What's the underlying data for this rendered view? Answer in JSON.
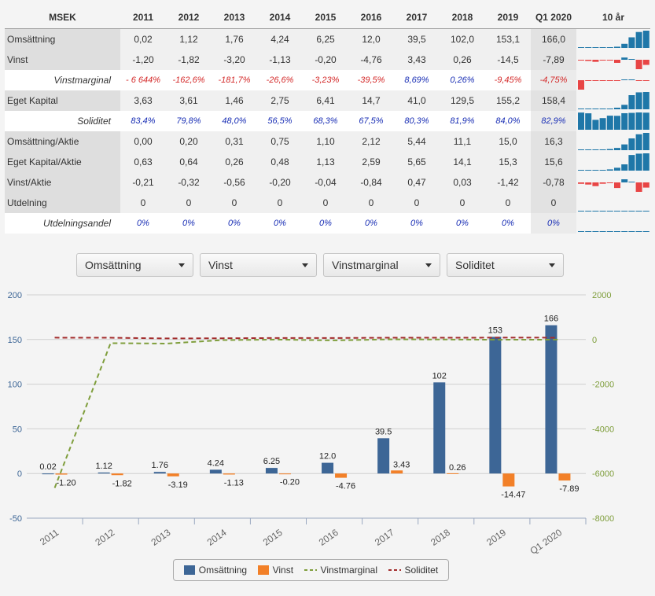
{
  "table": {
    "unit_header": "MSEK",
    "years": [
      "2011",
      "2012",
      "2013",
      "2014",
      "2015",
      "2016",
      "2017",
      "2018",
      "2019",
      "Q1 2020"
    ],
    "spark_header": "10 år",
    "rows": [
      {
        "label": "Omsättning",
        "style": "grey",
        "italic": false,
        "values": [
          "0,02",
          "1,12",
          "1,76",
          "4,24",
          "6,25",
          "12,0",
          "39,5",
          "102,0",
          "153,1",
          "166,0"
        ],
        "spark": [
          0.02,
          1.12,
          1.76,
          4.24,
          6.25,
          12.0,
          39.5,
          102.0,
          153.1,
          166.0
        ]
      },
      {
        "label": "Vinst",
        "style": "grey",
        "italic": false,
        "values": [
          "-1,20",
          "-1,82",
          "-3,20",
          "-1,13",
          "-0,20",
          "-4,76",
          "3,43",
          "0,26",
          "-14,5",
          "-7,89"
        ],
        "spark": [
          -1.2,
          -1.82,
          -3.2,
          -1.13,
          -0.2,
          -4.76,
          3.43,
          0.26,
          -14.5,
          -7.89
        ]
      },
      {
        "label": "Vinstmarginal",
        "style": "white",
        "italic": true,
        "values": [
          "- 6 644%",
          "-162,6%",
          "-181,7%",
          "-26,6%",
          "-3,23%",
          "-39,5%",
          "8,69%",
          "0,26%",
          "-9,45%",
          "-4,75%"
        ],
        "spark": [
          -6644,
          -162.6,
          -181.7,
          -26.6,
          -3.23,
          -39.5,
          8.69,
          0.26,
          -9.45,
          -4.75
        ]
      },
      {
        "label": "Eget Kapital",
        "style": "grey",
        "italic": false,
        "values": [
          "3,63",
          "3,61",
          "1,46",
          "2,75",
          "6,41",
          "14,7",
          "41,0",
          "129,5",
          "155,2",
          "158,4"
        ],
        "spark": [
          3.63,
          3.61,
          1.46,
          2.75,
          6.41,
          14.7,
          41.0,
          129.5,
          155.2,
          158.4
        ]
      },
      {
        "label": "Soliditet",
        "style": "white",
        "italic": true,
        "values": [
          "83,4%",
          "79,8%",
          "48,0%",
          "56,5%",
          "68,3%",
          "67,5%",
          "80,3%",
          "81,9%",
          "84,0%",
          "82,9%"
        ],
        "spark": [
          83.4,
          79.8,
          48.0,
          56.5,
          68.3,
          67.5,
          80.3,
          81.9,
          84.0,
          82.9
        ]
      },
      {
        "label": "Omsättning/Aktie",
        "style": "grey",
        "italic": false,
        "values": [
          "0,00",
          "0,20",
          "0,31",
          "0,75",
          "1,10",
          "2,12",
          "5,44",
          "11,1",
          "15,0",
          "16,3"
        ],
        "spark": [
          0.0,
          0.2,
          0.31,
          0.75,
          1.1,
          2.12,
          5.44,
          11.1,
          15.0,
          16.3
        ]
      },
      {
        "label": "Eget Kapital/Aktie",
        "style": "grey",
        "italic": false,
        "values": [
          "0,63",
          "0,64",
          "0,26",
          "0,48",
          "1,13",
          "2,59",
          "5,65",
          "14,1",
          "15,3",
          "15,6"
        ],
        "spark": [
          0.63,
          0.64,
          0.26,
          0.48,
          1.13,
          2.59,
          5.65,
          14.1,
          15.3,
          15.6
        ]
      },
      {
        "label": "Vinst/Aktie",
        "style": "grey",
        "italic": false,
        "values": [
          "-0,21",
          "-0,32",
          "-0,56",
          "-0,20",
          "-0,04",
          "-0,84",
          "0,47",
          "0,03",
          "-1,42",
          "-0,78"
        ],
        "spark": [
          -0.21,
          -0.32,
          -0.56,
          -0.2,
          -0.04,
          -0.84,
          0.47,
          0.03,
          -1.42,
          -0.78
        ]
      },
      {
        "label": "Utdelning",
        "style": "grey",
        "italic": false,
        "values": [
          "0",
          "0",
          "0",
          "0",
          "0",
          "0",
          "0",
          "0",
          "0",
          "0"
        ],
        "spark": [
          0,
          0,
          0,
          0,
          0,
          0,
          0,
          0,
          0,
          0
        ]
      },
      {
        "label": "Utdelningsandel",
        "style": "white",
        "italic": true,
        "values": [
          "0%",
          "0%",
          "0%",
          "0%",
          "0%",
          "0%",
          "0%",
          "0%",
          "0%",
          "0%"
        ],
        "spark": [
          0,
          0,
          0,
          0,
          0,
          0,
          0,
          0,
          0,
          0
        ]
      }
    ]
  },
  "dropdowns": [
    "Omsättning",
    "Vinst",
    "Vinstmarginal",
    "Soliditet"
  ],
  "colors": {
    "omsattning": "#3d6696",
    "vinst": "#f28028",
    "vinstmarginal": "#7f9e3c",
    "soliditet": "#a32d2d",
    "spark_pos": "#1f77a8",
    "spark_neg": "#e84545",
    "text_neg": "#d42a2a",
    "text_pos": "#1a2fb5"
  },
  "chart_data": {
    "type": "bar",
    "categories": [
      "2011",
      "2012",
      "2013",
      "2014",
      "2015",
      "2016",
      "2017",
      "2018",
      "2019",
      "Q1 2020"
    ],
    "left_axis": {
      "ticks": [
        "200",
        "150",
        "100",
        "50",
        "0",
        "-50"
      ],
      "ylim": [
        -50,
        200
      ]
    },
    "right_axis": {
      "ticks": [
        "2000",
        "0",
        "-2000",
        "-4000",
        "-6000",
        "-8000"
      ],
      "ylim": [
        -8000,
        2000
      ]
    },
    "series": [
      {
        "name": "Omsättning",
        "kind": "bar",
        "axis": "left",
        "values": [
          0.02,
          1.12,
          1.76,
          4.24,
          6.25,
          12.0,
          39.5,
          102,
          153,
          166
        ],
        "labels": [
          "0.02",
          "1.12",
          "1.76",
          "4.24",
          "6.25",
          "12.0",
          "39.5",
          "102",
          "153",
          "166"
        ]
      },
      {
        "name": "Vinst",
        "kind": "bar",
        "axis": "left",
        "values": [
          -1.2,
          -1.82,
          -3.19,
          -1.13,
          -0.2,
          -4.76,
          3.43,
          0.26,
          -14.47,
          -7.89
        ],
        "labels": [
          "-1.20",
          "-1.82",
          "-3.19",
          "-1.13",
          "-0.20",
          "-4.76",
          "3.43",
          "0.26",
          "-14.47",
          "-7.89"
        ]
      },
      {
        "name": "Vinstmarginal",
        "kind": "line",
        "axis": "right",
        "values": [
          -6644,
          -162.6,
          -181.7,
          -26.6,
          -3.23,
          -39.5,
          8.69,
          0.26,
          -9.45,
          -4.75
        ]
      },
      {
        "name": "Soliditet",
        "kind": "line",
        "axis": "right",
        "values": [
          83.4,
          79.8,
          48.0,
          56.5,
          68.3,
          67.5,
          80.3,
          81.9,
          84.0,
          82.9
        ]
      }
    ]
  }
}
